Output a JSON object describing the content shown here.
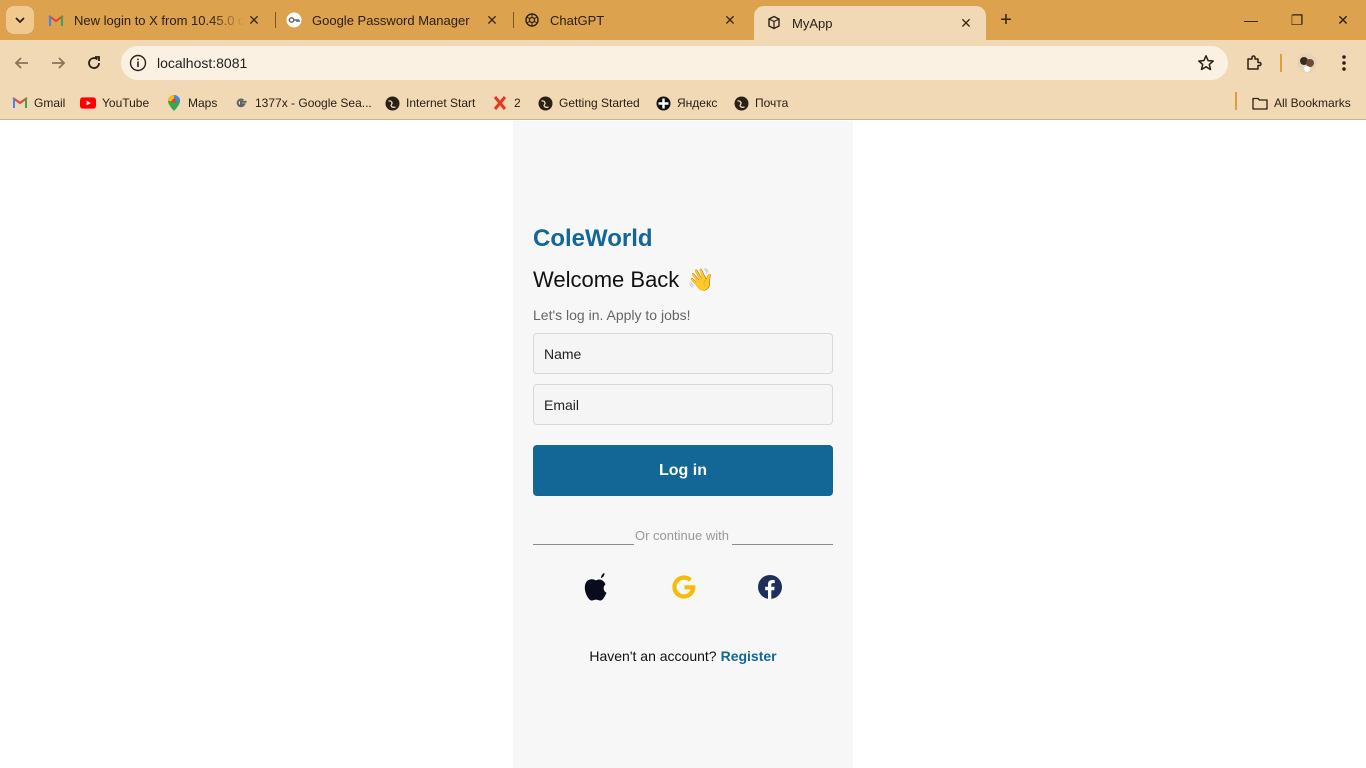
{
  "browser": {
    "tabs": [
      {
        "title": "New login to X from 10.45.0 on",
        "icon": "gmail-icon"
      },
      {
        "title": "Google Password Manager",
        "icon": "password-manager-icon"
      },
      {
        "title": "ChatGPT",
        "icon": "chatgpt-icon"
      },
      {
        "title": "MyApp",
        "icon": "myapp-icon",
        "active": true
      }
    ],
    "close_glyph": "✕",
    "new_tab_glyph": "+",
    "window_controls": {
      "minimize": "—",
      "restore": "❐",
      "close": "✕"
    },
    "address": "localhost:8081",
    "bookmarks": [
      {
        "label": "Gmail",
        "icon": "gmail-icon"
      },
      {
        "label": "YouTube",
        "icon": "youtube-icon"
      },
      {
        "label": "Maps",
        "icon": "maps-icon"
      },
      {
        "label": "1377x - Google Sea...",
        "icon": "google-icon"
      },
      {
        "label": "Internet Start",
        "icon": "globe-icon"
      },
      {
        "label": "2",
        "icon": "x-icon"
      },
      {
        "label": "Getting Started",
        "icon": "globe-icon"
      },
      {
        "label": "Яндекс",
        "icon": "yandex-icon"
      },
      {
        "label": "Почта",
        "icon": "globe-icon"
      }
    ],
    "all_bookmarks": "All Bookmarks"
  },
  "login": {
    "brand": "ColeWorld",
    "welcome": "Welcome Back",
    "wave_emoji": "👋",
    "subtitle": "Let's log in. Apply to jobs!",
    "name_placeholder": "Name",
    "email_placeholder": "Email",
    "login_button": "Log in",
    "divider_text": "Or continue with",
    "social": [
      "apple-icon",
      "google-icon",
      "facebook-icon"
    ],
    "register_prompt": "Haven't an account?",
    "register_link": "Register"
  },
  "colors": {
    "accent": "#136797",
    "tabstrip": "#dda24d",
    "toolbar": "#f1d9b5",
    "panel": "#f7f7f7"
  }
}
